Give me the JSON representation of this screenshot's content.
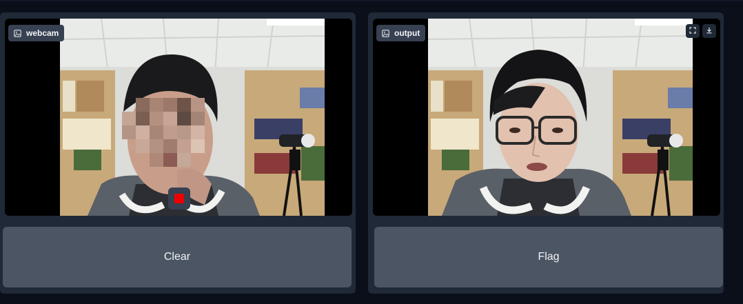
{
  "input_panel": {
    "label": "webcam",
    "label_icon": "image-icon",
    "record_icon": "stop-square-icon",
    "record_color": "#ef0000"
  },
  "output_panel": {
    "label": "output",
    "label_icon": "image-icon",
    "fullscreen_icon": "fullscreen-icon",
    "download_icon": "download-icon"
  },
  "buttons": {
    "clear_label": "Clear",
    "flag_label": "Flag"
  },
  "colors": {
    "page_bg": "#0b0f19",
    "panel_bg": "#1f2937",
    "button_bg": "#4b5563",
    "chip_bg": "#374151"
  }
}
